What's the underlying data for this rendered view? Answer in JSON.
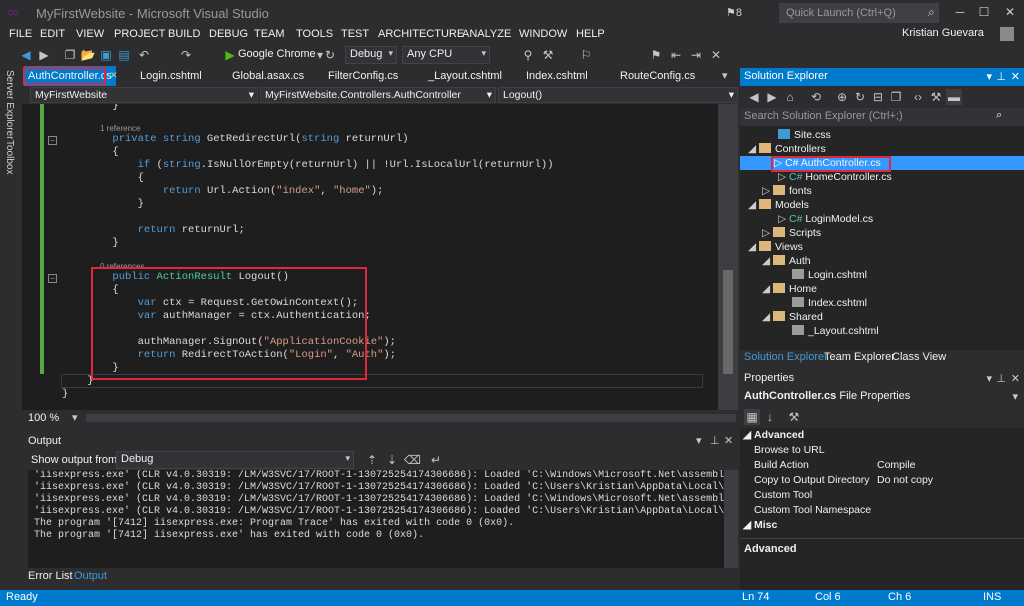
{
  "window": {
    "title": "MyFirstWebsite - Microsoft Visual Studio",
    "notifications": "8",
    "quick_launch_placeholder": "Quick Launch (Ctrl+Q)",
    "user": "Kristian Guevara"
  },
  "menu": [
    "FILE",
    "EDIT",
    "VIEW",
    "PROJECT",
    "BUILD",
    "DEBUG",
    "TEAM",
    "TOOLS",
    "TEST",
    "ARCHITECTURE",
    "ANALYZE",
    "WINDOW",
    "HELP"
  ],
  "toolbar": {
    "browser": "Google Chrome",
    "config": "Debug",
    "platform": "Any CPU"
  },
  "left_tabs": [
    "Server Explorer",
    "Toolbox"
  ],
  "doc_tabs": [
    "AuthController.cs",
    "Login.cshtml",
    "Global.asax.cs",
    "FilterConfig.cs",
    "_Layout.cshtml",
    "Index.cshtml",
    "RouteConfig.cs"
  ],
  "nav": {
    "project": "MyFirstWebsite",
    "class": "MyFirstWebsite.Controllers.AuthController",
    "member": "Logout()"
  },
  "editor": {
    "zoom": "100 %",
    "ref1": "1 reference",
    "ref0": "0 references",
    "lines": {
      "l0": "        }",
      "l2a": "        private string GetRedirectUrl(string returnUrl)",
      "l3": "        {",
      "l4": "            if (string.IsNullOrEmpty(returnUrl) || !Url.IsLocalUrl(returnUrl))",
      "l5": "            {",
      "l6": "                return Url.Action(\"index\", \"home\");",
      "l7": "            }",
      "l9": "            return returnUrl;",
      "l10": "        }",
      "l12": "        public ActionResult Logout()",
      "l13": "        {",
      "l14": "            var ctx = Request.GetOwinContext();",
      "l15": "            var authManager = ctx.Authentication;",
      "l17": "            authManager.SignOut(\"ApplicationCookie\");",
      "l18": "            return RedirectToAction(\"Login\", \"Auth\");",
      "l19": "        }",
      "l20": "    }",
      "l21": "}"
    }
  },
  "output": {
    "title": "Output",
    "show_label": "Show output from:",
    "source": "Debug",
    "lines": [
      "'iisexpress.exe' (CLR v4.0.30319: /LM/W3SVC/17/ROOT-1-130725254174306686): Loaded 'C:\\Windows\\Microsoft.Net\\assembly\\GAC_MS",
      "'iisexpress.exe' (CLR v4.0.30319: /LM/W3SVC/17/ROOT-1-130725254174306686): Loaded 'C:\\Users\\Kristian\\AppData\\Local\\Temp\\Tem",
      "'iisexpress.exe' (CLR v4.0.30319: /LM/W3SVC/17/ROOT-1-130725254174306686): Loaded 'C:\\Windows\\Microsoft.Net\\assembly\\GAC_MS",
      "'iisexpress.exe' (CLR v4.0.30319: /LM/W3SVC/17/ROOT-1-130725254174306686): Loaded 'C:\\Users\\Kristian\\AppData\\Local\\Temp\\Tem",
      "The program '[7412] iisexpress.exe: Program Trace' has exited with code 0 (0x0).",
      "The program '[7412] iisexpress.exe' has exited with code 0 (0x0)."
    ],
    "tabs": [
      "Error List",
      "Output"
    ]
  },
  "solution_explorer": {
    "title": "Solution Explorer",
    "search_placeholder": "Search Solution Explorer (Ctrl+;)",
    "nodes": [
      {
        "label": "Site.css",
        "type": "file"
      },
      {
        "label": "Controllers",
        "type": "folder"
      },
      {
        "label": "AuthController.cs",
        "type": "cs"
      },
      {
        "label": "HomeController.cs",
        "type": "cs"
      },
      {
        "label": "fonts",
        "type": "folder"
      },
      {
        "label": "Models",
        "type": "folder"
      },
      {
        "label": "LoginModel.cs",
        "type": "cs"
      },
      {
        "label": "Scripts",
        "type": "folder"
      },
      {
        "label": "Views",
        "type": "folder"
      },
      {
        "label": "Auth",
        "type": "folder"
      },
      {
        "label": "Login.cshtml",
        "type": "file"
      },
      {
        "label": "Home",
        "type": "folder"
      },
      {
        "label": "Index.cshtml",
        "type": "file"
      },
      {
        "label": "Shared",
        "type": "folder"
      },
      {
        "label": "_Layout.cshtml",
        "type": "file"
      }
    ],
    "tabs": [
      "Solution Explorer",
      "Team Explorer",
      "Class View"
    ]
  },
  "properties": {
    "title": "Properties",
    "object": "AuthController.cs",
    "object_type": "File Properties",
    "cat_advanced": "Advanced",
    "rows": [
      {
        "name": "Browse to URL",
        "value": ""
      },
      {
        "name": "Build Action",
        "value": "Compile"
      },
      {
        "name": "Copy to Output Directory",
        "value": "Do not copy"
      },
      {
        "name": "Custom Tool",
        "value": ""
      },
      {
        "name": "Custom Tool Namespace",
        "value": ""
      }
    ],
    "cat_misc": "Misc",
    "desc": "Advanced"
  },
  "status": {
    "ready": "Ready",
    "ln": "Ln 74",
    "col": "Col 6",
    "ch": "Ch 6",
    "mode": "INS"
  }
}
